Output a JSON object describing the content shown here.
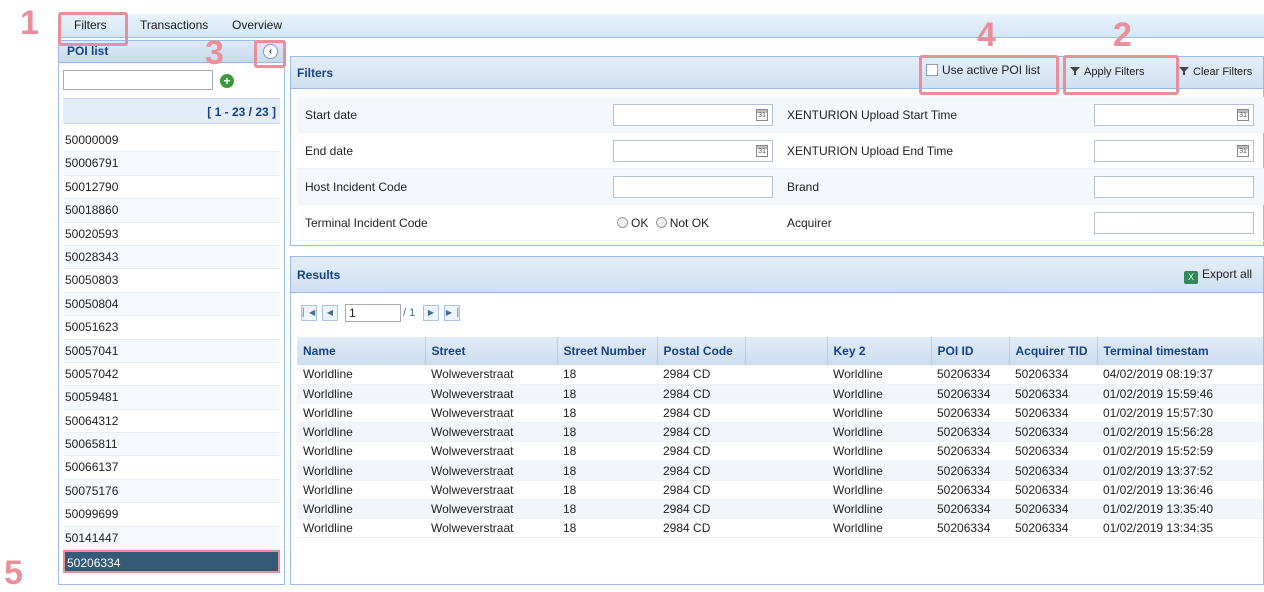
{
  "topbar": {
    "tabs": [
      "Filters",
      "Transactions",
      "Overview"
    ]
  },
  "poi_panel": {
    "title": "POI list",
    "range": "[ 1 - 23 / 23 ]",
    "items": [
      "50000009",
      "50006791",
      "50012790",
      "50018860",
      "50020593",
      "50028343",
      "50050803",
      "50050804",
      "50051623",
      "50057041",
      "50057042",
      "50059481",
      "50064312",
      "50065811",
      "50066137",
      "50075176",
      "50099699",
      "50141447",
      "50206334"
    ],
    "selected": "50206334"
  },
  "filters": {
    "title": "Filters",
    "use_active_label": "Use active POI list",
    "apply_label": "Apply Filters",
    "clear_label": "Clear Filters",
    "rows": [
      {
        "left": "Start date",
        "right": "XENTURION Upload Start Time"
      },
      {
        "left": "End date",
        "right": "XENTURION Upload End Time"
      },
      {
        "left": "Host Incident Code",
        "right": "Brand"
      },
      {
        "left": "Terminal Incident Code",
        "right": "Acquirer"
      }
    ],
    "ok_label": "OK",
    "notok_label": "Not OK"
  },
  "results": {
    "title": "Results",
    "export_label": "Export all",
    "page_value": "1",
    "page_total": "/ 1",
    "columns": [
      "Name",
      "Street",
      "Street Number",
      "Postal Code",
      "",
      "Key 2",
      "POI ID",
      "Acquirer TID",
      "Terminal timestam"
    ],
    "rows": [
      [
        "Worldline",
        "Wolweverstraat",
        "18",
        "2984 CD",
        "",
        "Worldline",
        "50206334",
        "50206334",
        "04/02/2019 08:19:37"
      ],
      [
        "Worldline",
        "Wolweverstraat",
        "18",
        "2984 CD",
        "",
        "Worldline",
        "50206334",
        "50206334",
        "01/02/2019 15:59:46"
      ],
      [
        "Worldline",
        "Wolweverstraat",
        "18",
        "2984 CD",
        "",
        "Worldline",
        "50206334",
        "50206334",
        "01/02/2019 15:57:30"
      ],
      [
        "Worldline",
        "Wolweverstraat",
        "18",
        "2984 CD",
        "",
        "Worldline",
        "50206334",
        "50206334",
        "01/02/2019 15:56:28"
      ],
      [
        "Worldline",
        "Wolweverstraat",
        "18",
        "2984 CD",
        "",
        "Worldline",
        "50206334",
        "50206334",
        "01/02/2019 15:52:59"
      ],
      [
        "Worldline",
        "Wolweverstraat",
        "18",
        "2984 CD",
        "",
        "Worldline",
        "50206334",
        "50206334",
        "01/02/2019 13:37:52"
      ],
      [
        "Worldline",
        "Wolweverstraat",
        "18",
        "2984 CD",
        "",
        "Worldline",
        "50206334",
        "50206334",
        "01/02/2019 13:36:46"
      ],
      [
        "Worldline",
        "Wolweverstraat",
        "18",
        "2984 CD",
        "",
        "Worldline",
        "50206334",
        "50206334",
        "01/02/2019 13:35:40"
      ],
      [
        "Worldline",
        "Wolweverstraat",
        "18",
        "2984 CD",
        "",
        "Worldline",
        "50206334",
        "50206334",
        "01/02/2019 13:34:35"
      ]
    ]
  },
  "annotations": {
    "numbers": [
      "1",
      "2",
      "3",
      "4",
      "5"
    ],
    "highlight_color": "#e98f9a"
  },
  "icons": [
    "collapse-left-icon",
    "add-icon",
    "calendar-icon",
    "filter-icon",
    "excel-icon",
    "first-page-icon",
    "prev-page-icon",
    "next-page-icon",
    "last-page-icon"
  ]
}
